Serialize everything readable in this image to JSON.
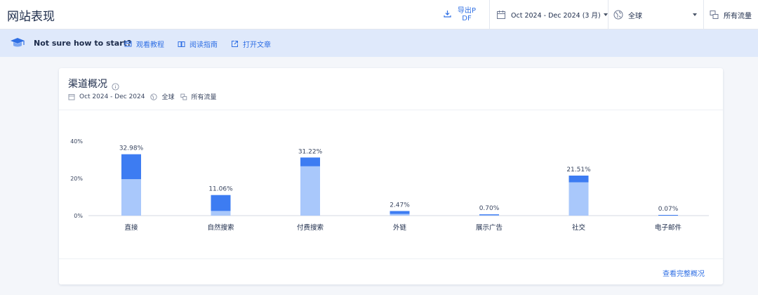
{
  "header": {
    "title": "网站表现",
    "export_label": "导出PDF",
    "date_range": "Oct 2024 - Dec 2024 (3 月)",
    "region": "全球",
    "traffic": "所有流量"
  },
  "banner": {
    "question": "Not sure how to start?",
    "links": [
      "观看教程",
      "阅读指南",
      "打开文章"
    ]
  },
  "card": {
    "title": "渠道概况",
    "meta_date": "Oct 2024 - Dec 2024",
    "meta_region": "全球",
    "meta_traffic": "所有流量",
    "full_link": "查看完整概况"
  },
  "colors": {
    "accent": "#2f6fe4",
    "bar_dark": "#3d7cf2",
    "bar_light": "#a9c8fb",
    "banner_bg": "#dfe9fb"
  },
  "chart_data": {
    "type": "bar",
    "stacked": true,
    "categories": [
      "直接",
      "自然搜索",
      "付费搜索",
      "外链",
      "展示广告",
      "社交",
      "电子邮件"
    ],
    "totals": [
      32.98,
      11.06,
      31.22,
      2.47,
      0.7,
      21.51,
      0.07
    ],
    "total_labels": [
      "32.98%",
      "11.06%",
      "31.22%",
      "2.47%",
      "0.70%",
      "21.51%",
      "0.07%"
    ],
    "series": [
      {
        "values": [
          19.6,
          2.5,
          26.5,
          0.9,
          0.2,
          17.9,
          0.0
        ]
      },
      {
        "values": [
          13.38,
          8.56,
          4.72,
          1.57,
          0.5,
          3.61,
          0.07
        ]
      }
    ],
    "ylim": [
      0,
      40
    ],
    "yticks": [
      0,
      20,
      40
    ],
    "ytick_labels": [
      "0%",
      "20%",
      "40%"
    ],
    "grid": false
  }
}
